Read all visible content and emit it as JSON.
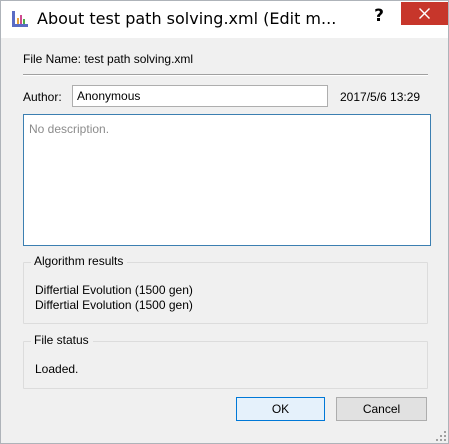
{
  "window": {
    "title": "About test path solving.xml (Edit m...",
    "help_label": "?",
    "icons": {
      "app": "app-icon",
      "help": "help-icon",
      "close": "close-icon",
      "grip": "resize-grip-icon"
    },
    "colors": {
      "close_bg": "#c7362b",
      "focus_border": "#0078d7"
    }
  },
  "file": {
    "name_line": "File Name: test path solving.xml"
  },
  "author": {
    "label": "Author:",
    "value": "Anonymous",
    "date": "2017/5/6 13:29"
  },
  "description": {
    "placeholder": "No description."
  },
  "algorithm_results": {
    "title": "Algorithm results",
    "items": [
      "Differtial Evolution (1500 gen)",
      "Differtial Evolution (1500 gen)"
    ]
  },
  "file_status": {
    "title": "File status",
    "text": "Loaded."
  },
  "buttons": {
    "ok": "OK",
    "cancel": "Cancel"
  }
}
